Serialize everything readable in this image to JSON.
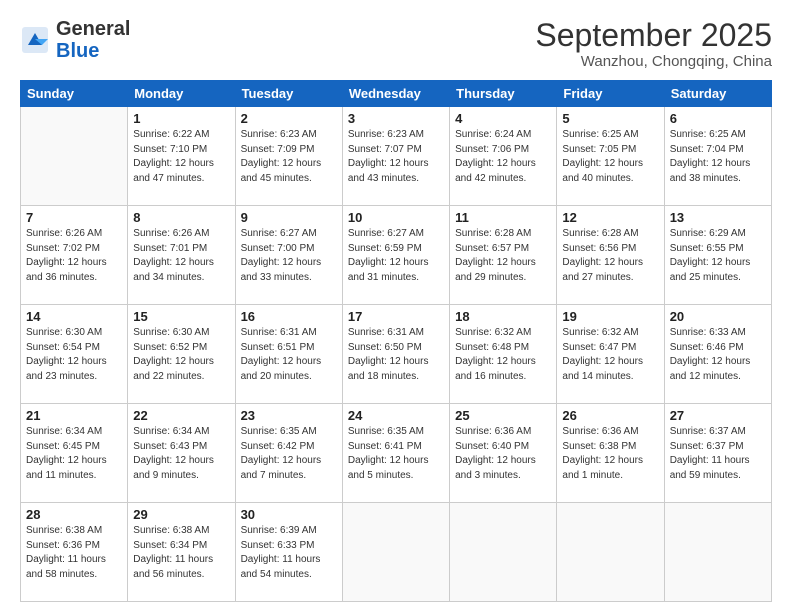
{
  "header": {
    "logo_general": "General",
    "logo_blue": "Blue",
    "month": "September 2025",
    "location": "Wanzhou, Chongqing, China"
  },
  "weekdays": [
    "Sunday",
    "Monday",
    "Tuesday",
    "Wednesday",
    "Thursday",
    "Friday",
    "Saturday"
  ],
  "weeks": [
    [
      {
        "day": "",
        "info": ""
      },
      {
        "day": "1",
        "info": "Sunrise: 6:22 AM\nSunset: 7:10 PM\nDaylight: 12 hours\nand 47 minutes."
      },
      {
        "day": "2",
        "info": "Sunrise: 6:23 AM\nSunset: 7:09 PM\nDaylight: 12 hours\nand 45 minutes."
      },
      {
        "day": "3",
        "info": "Sunrise: 6:23 AM\nSunset: 7:07 PM\nDaylight: 12 hours\nand 43 minutes."
      },
      {
        "day": "4",
        "info": "Sunrise: 6:24 AM\nSunset: 7:06 PM\nDaylight: 12 hours\nand 42 minutes."
      },
      {
        "day": "5",
        "info": "Sunrise: 6:25 AM\nSunset: 7:05 PM\nDaylight: 12 hours\nand 40 minutes."
      },
      {
        "day": "6",
        "info": "Sunrise: 6:25 AM\nSunset: 7:04 PM\nDaylight: 12 hours\nand 38 minutes."
      }
    ],
    [
      {
        "day": "7",
        "info": "Sunrise: 6:26 AM\nSunset: 7:02 PM\nDaylight: 12 hours\nand 36 minutes."
      },
      {
        "day": "8",
        "info": "Sunrise: 6:26 AM\nSunset: 7:01 PM\nDaylight: 12 hours\nand 34 minutes."
      },
      {
        "day": "9",
        "info": "Sunrise: 6:27 AM\nSunset: 7:00 PM\nDaylight: 12 hours\nand 33 minutes."
      },
      {
        "day": "10",
        "info": "Sunrise: 6:27 AM\nSunset: 6:59 PM\nDaylight: 12 hours\nand 31 minutes."
      },
      {
        "day": "11",
        "info": "Sunrise: 6:28 AM\nSunset: 6:57 PM\nDaylight: 12 hours\nand 29 minutes."
      },
      {
        "day": "12",
        "info": "Sunrise: 6:28 AM\nSunset: 6:56 PM\nDaylight: 12 hours\nand 27 minutes."
      },
      {
        "day": "13",
        "info": "Sunrise: 6:29 AM\nSunset: 6:55 PM\nDaylight: 12 hours\nand 25 minutes."
      }
    ],
    [
      {
        "day": "14",
        "info": "Sunrise: 6:30 AM\nSunset: 6:54 PM\nDaylight: 12 hours\nand 23 minutes."
      },
      {
        "day": "15",
        "info": "Sunrise: 6:30 AM\nSunset: 6:52 PM\nDaylight: 12 hours\nand 22 minutes."
      },
      {
        "day": "16",
        "info": "Sunrise: 6:31 AM\nSunset: 6:51 PM\nDaylight: 12 hours\nand 20 minutes."
      },
      {
        "day": "17",
        "info": "Sunrise: 6:31 AM\nSunset: 6:50 PM\nDaylight: 12 hours\nand 18 minutes."
      },
      {
        "day": "18",
        "info": "Sunrise: 6:32 AM\nSunset: 6:48 PM\nDaylight: 12 hours\nand 16 minutes."
      },
      {
        "day": "19",
        "info": "Sunrise: 6:32 AM\nSunset: 6:47 PM\nDaylight: 12 hours\nand 14 minutes."
      },
      {
        "day": "20",
        "info": "Sunrise: 6:33 AM\nSunset: 6:46 PM\nDaylight: 12 hours\nand 12 minutes."
      }
    ],
    [
      {
        "day": "21",
        "info": "Sunrise: 6:34 AM\nSunset: 6:45 PM\nDaylight: 12 hours\nand 11 minutes."
      },
      {
        "day": "22",
        "info": "Sunrise: 6:34 AM\nSunset: 6:43 PM\nDaylight: 12 hours\nand 9 minutes."
      },
      {
        "day": "23",
        "info": "Sunrise: 6:35 AM\nSunset: 6:42 PM\nDaylight: 12 hours\nand 7 minutes."
      },
      {
        "day": "24",
        "info": "Sunrise: 6:35 AM\nSunset: 6:41 PM\nDaylight: 12 hours\nand 5 minutes."
      },
      {
        "day": "25",
        "info": "Sunrise: 6:36 AM\nSunset: 6:40 PM\nDaylight: 12 hours\nand 3 minutes."
      },
      {
        "day": "26",
        "info": "Sunrise: 6:36 AM\nSunset: 6:38 PM\nDaylight: 12 hours\nand 1 minute."
      },
      {
        "day": "27",
        "info": "Sunrise: 6:37 AM\nSunset: 6:37 PM\nDaylight: 11 hours\nand 59 minutes."
      }
    ],
    [
      {
        "day": "28",
        "info": "Sunrise: 6:38 AM\nSunset: 6:36 PM\nDaylight: 11 hours\nand 58 minutes."
      },
      {
        "day": "29",
        "info": "Sunrise: 6:38 AM\nSunset: 6:34 PM\nDaylight: 11 hours\nand 56 minutes."
      },
      {
        "day": "30",
        "info": "Sunrise: 6:39 AM\nSunset: 6:33 PM\nDaylight: 11 hours\nand 54 minutes."
      },
      {
        "day": "",
        "info": ""
      },
      {
        "day": "",
        "info": ""
      },
      {
        "day": "",
        "info": ""
      },
      {
        "day": "",
        "info": ""
      }
    ]
  ]
}
